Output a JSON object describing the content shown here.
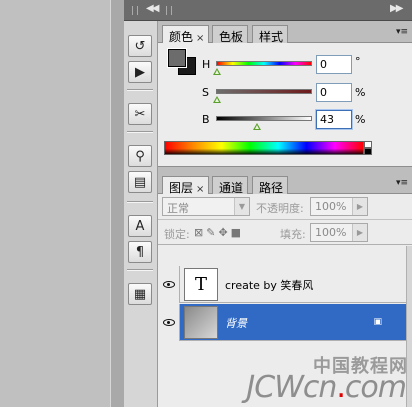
{
  "color_panel": {
    "tabs": [
      {
        "label": "颜色",
        "close": "×",
        "active": true
      },
      {
        "label": "色板",
        "active": false
      },
      {
        "label": "样式",
        "active": false
      }
    ],
    "menu_icon": "panel-menu-icon",
    "channels": [
      {
        "label": "H",
        "value": "0",
        "unit": "°",
        "slider_position": 0.0
      },
      {
        "label": "S",
        "value": "0",
        "unit": "%",
        "slider_position": 0.0
      },
      {
        "label": "B",
        "value": "43",
        "unit": "%",
        "slider_position": 0.43
      }
    ],
    "foreground_color": "#6c6c6c",
    "background_color": "#1a1a1a"
  },
  "layers_panel": {
    "tabs": [
      {
        "label": "图层",
        "close": "×",
        "active": true
      },
      {
        "label": "通道",
        "active": false
      },
      {
        "label": "路径",
        "active": false
      }
    ],
    "blend_mode": "正常",
    "opacity_label": "不透明度:",
    "opacity_value": "100%",
    "lock_label": "锁定:",
    "fill_label": "填充:",
    "fill_value": "100%",
    "layers": [
      {
        "name": "create by 笑春风",
        "thumbnail": "T",
        "type": "text",
        "visible": true,
        "selected": false
      },
      {
        "name": "背景",
        "type": "background",
        "visible": true,
        "selected": true,
        "locked": true
      }
    ]
  },
  "icon_strip": {
    "tools": [
      {
        "name": "history-icon",
        "glyph": "↺"
      },
      {
        "name": "actions-icon",
        "glyph": "▶"
      },
      {
        "name": "tool-presets-icon",
        "glyph": "✂"
      },
      {
        "name": "brushes-icon",
        "glyph": "⚲"
      },
      {
        "name": "clone-source-icon",
        "glyph": "▤"
      },
      {
        "name": "character-icon",
        "glyph": "A"
      },
      {
        "name": "paragraph-icon",
        "glyph": "¶"
      },
      {
        "name": "layer-comps-icon",
        "glyph": "▦"
      }
    ]
  },
  "watermark": {
    "line1": "中国教程网",
    "line2_a": "JCWcn",
    "line2_dot": ".",
    "line2_b": "com"
  },
  "colors": {
    "selection": "#316ac5",
    "slider_thumb": "#5aa02c",
    "focus_border": "#3c6fb6"
  }
}
